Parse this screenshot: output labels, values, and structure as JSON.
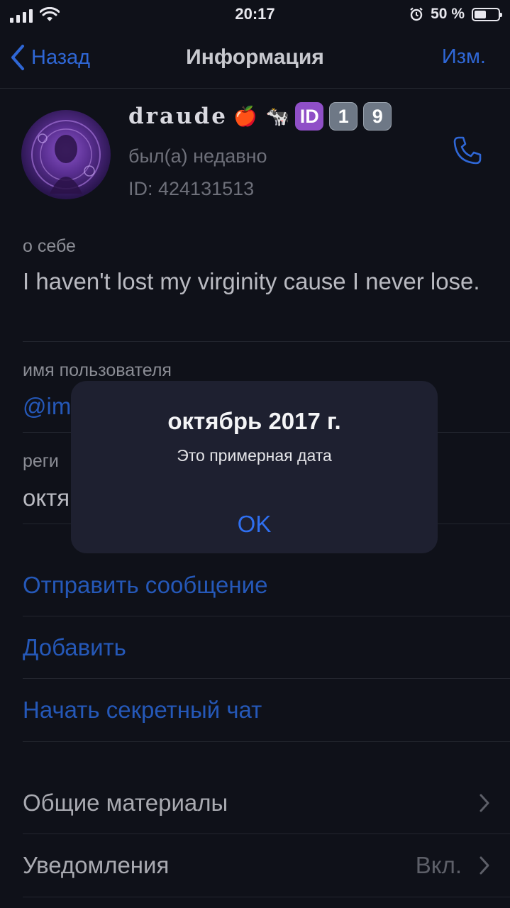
{
  "status": {
    "time": "20:17",
    "battery": "50 %",
    "battery_level": 0.5
  },
  "nav": {
    "back": "Назад",
    "title": "Информация",
    "edit": "Изм."
  },
  "profile": {
    "name": "draude",
    "emoji": [
      "🍎",
      "🐄"
    ],
    "badges": [
      "ID",
      "1",
      "9"
    ],
    "last_seen": "был(а) недавно",
    "id": "ID: 424131513"
  },
  "about": {
    "label": "о себе",
    "text": "I haven't lost my virginity cause I never lose."
  },
  "username": {
    "label": "имя пользователя",
    "value": "@im"
  },
  "registration": {
    "label": "реги",
    "value": "октя"
  },
  "actions": {
    "send_message": "Отправить сообщение",
    "add": "Добавить",
    "secret_chat": "Начать секретный чат"
  },
  "menu": {
    "shared_media": "Общие материалы",
    "notifications": "Уведомления",
    "notifications_value": "Вкл."
  },
  "alert": {
    "title": "октябрь 2017 г.",
    "message": "Это примерная дата",
    "ok": "OK"
  },
  "colors": {
    "accent": "#2f67d6",
    "background": "#0f1119",
    "alert_bg": "#1e2030"
  }
}
